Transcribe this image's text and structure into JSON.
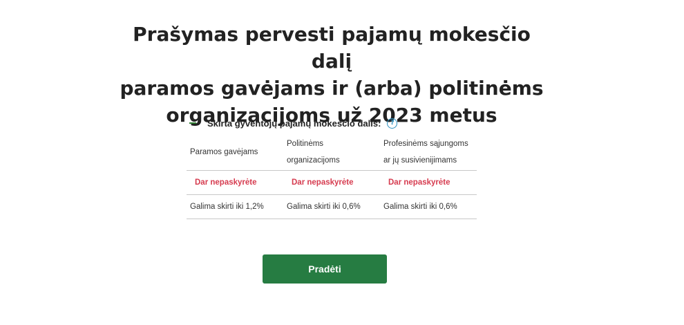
{
  "page": {
    "title_line1": "Prašymas pervesti pajamų mokesčio dalį",
    "title_line2": "paramos gavėjams ir (arba) politinėms",
    "title_line3": "organizacijoms už 2023 metus"
  },
  "section": {
    "title": "Skirta gyventojų pajamų mokesčio dalis:",
    "collapse_icon": "minus-icon",
    "help_icon": "question-circle-icon",
    "help_glyph": "?",
    "colors": {
      "accent": "#2e7d32",
      "help": "#2a8fbf",
      "warning": "#d63b4f"
    }
  },
  "table": {
    "columns": [
      {
        "line1": "Paramos gavėjams",
        "line2": ""
      },
      {
        "line1": "Politinėms",
        "line2": "organizacijoms"
      },
      {
        "line1": "Profesinėms sąjungoms",
        "line2": "ar jų susivienijimams"
      }
    ],
    "status": [
      "Dar nepaskyrėte",
      "Dar nepaskyrėte",
      "Dar nepaskyrėte"
    ],
    "limits": [
      "Galima skirti iki 1,2%",
      "Galima skirti iki 0,6%",
      "Galima skirti iki 0,6%"
    ]
  },
  "actions": {
    "start_label": "Pradėti",
    "start_color": "#267c42"
  }
}
